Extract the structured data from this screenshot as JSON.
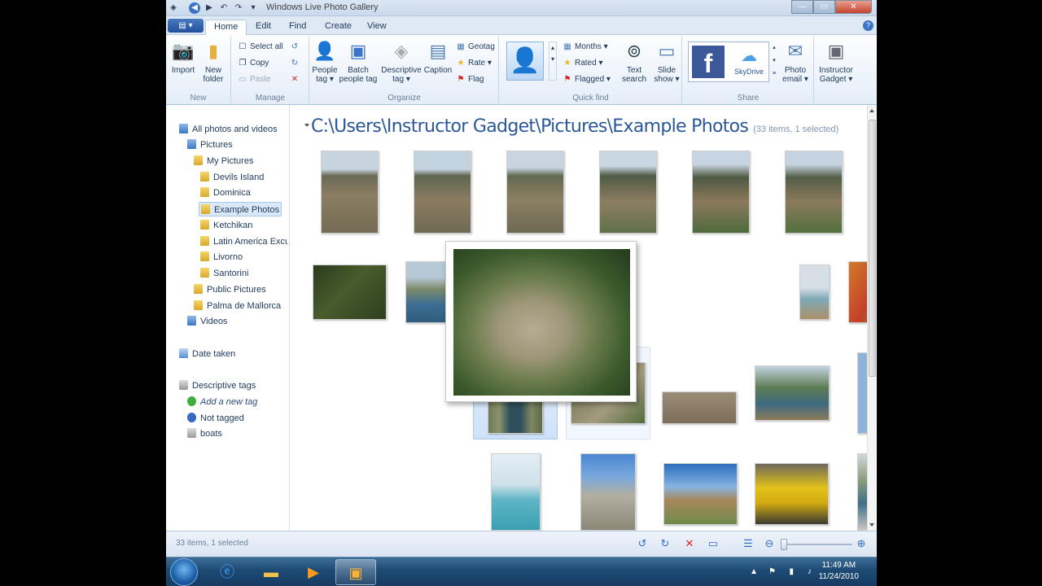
{
  "window": {
    "title": "Windows Live Photo Gallery",
    "help_label": "?",
    "controls": {
      "minimize": "—",
      "maximize": "▭",
      "close": "✕"
    }
  },
  "tabs": [
    "Home",
    "Edit",
    "Find",
    "Create",
    "View"
  ],
  "file_menu_icon": "file-menu-icon",
  "ribbon": {
    "new": {
      "label": "New",
      "import": "Import",
      "new_folder": [
        "New",
        "folder"
      ]
    },
    "manage": {
      "label": "Manage",
      "select_all": "Select all",
      "copy": "Copy",
      "paste": "Paste"
    },
    "organize": {
      "label": "Organize",
      "people_tag": [
        "People",
        "tag ▾"
      ],
      "batch_people_tag": [
        "Batch",
        "people tag"
      ],
      "descriptive_tag": [
        "Descriptive",
        "tag ▾"
      ],
      "caption": "Caption",
      "geotag": "Geotag",
      "rate": "Rate ▾",
      "flag": "Flag"
    },
    "quick_find": {
      "label": "Quick find",
      "months": "Months ▾",
      "rated": "Rated ▾",
      "flagged": "Flagged ▾",
      "text_search": [
        "Text",
        "search"
      ],
      "slide_show": [
        "Slide",
        "show ▾"
      ]
    },
    "share": {
      "label": "Share",
      "facebook": "f",
      "skydrive": "SkyDrive",
      "photo_email": [
        "Photo",
        "email ▾"
      ],
      "instructor_gadget": [
        "Instructor",
        "Gadget ▾"
      ]
    }
  },
  "sidebar": {
    "all_photos": "All photos and videos",
    "pictures": "Pictures",
    "my_pictures": "My Pictures",
    "folders": [
      "Devils Island",
      "Dominica",
      "Example Photos",
      "Ketchikan",
      "Latin America Excur",
      "Livorno",
      "Santorini"
    ],
    "public_pictures": "Public Pictures",
    "palma": "Palma de Mallorca",
    "videos": "Videos",
    "date_taken": "Date taken",
    "descriptive_tags": "Descriptive tags",
    "add_new_tag": "Add a new tag",
    "not_tagged": "Not tagged",
    "boats": "boats"
  },
  "main": {
    "path": "C:\\Users\\Instructor Gadget\\Pictures\\Example Photos",
    "count": "(33 items, 1 selected)"
  },
  "status": {
    "text": "33 items, 1 selected"
  },
  "taskbar": {
    "time": "11:49 AM",
    "date": "11/24/2010"
  },
  "colors": {
    "accent": "#2b5797",
    "selection": "#cfe2f9",
    "ribbon": "#e4edf8",
    "taskbar": "#1d4a74"
  }
}
